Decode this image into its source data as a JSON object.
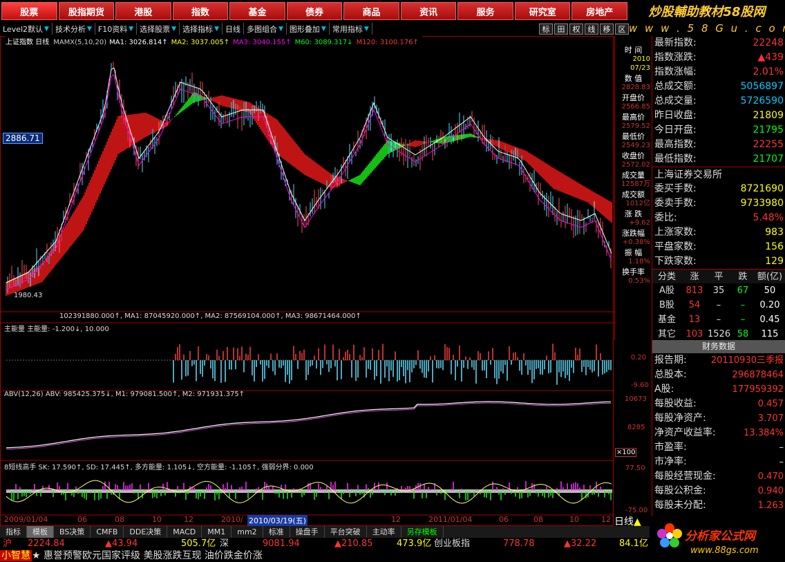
{
  "topnav": [
    "股票",
    "股指期货",
    "港股",
    "指数",
    "基金",
    "债券",
    "商品",
    "资讯",
    "服务",
    "研究室",
    "房地产"
  ],
  "brand": {
    "title": "炒股輔助教材58股网",
    "subtitle": "w w w . 5 8 G u . c o m"
  },
  "toolbar": {
    "items": [
      "Level2默认",
      "技术分析",
      "F10资料",
      "选择股票",
      "选择指标",
      "日线",
      "多图组合",
      "图形叠加",
      "常用指标"
    ]
  },
  "iconbar": [
    "标",
    "田",
    "权",
    "线",
    "移",
    "区"
  ],
  "chart": {
    "title": "上证指数 日线",
    "mamx": "MAMX(5,10,20)",
    "ma_line": [
      {
        "label": "MA1: 3026.814↑",
        "color": "#ffffff"
      },
      {
        "label": "MA2: 3037.005↑",
        "color": "#ffff00"
      },
      {
        "label": "MA3: 3040.155↑",
        "color": "#ff00ff"
      },
      {
        "label": "M60: 3089.317↓",
        "color": "#00ff00"
      },
      {
        "label": "M120: 3100.176↑",
        "color": "#ff3333"
      }
    ],
    "price_tag": "2886.71",
    "low_label": "1980.43",
    "vol_line": "102391880.000↑, MA1: 87045920.000↑, MA2: 87569104.000↑, MA3: 98671464.000↑",
    "zhu_title": "主能量 主能量: -1.200↓, 10.000",
    "zhu_axis": [
      "0.20",
      "-9.60"
    ],
    "abv_title": "ABV(12,26) ABV: 985425.375↓, M1: 979081.500↑, M2: 971931.375↑",
    "abv_axis": [
      "10673",
      "8285",
      "×100"
    ],
    "sk_title": "8短线高手 SK: 17.590↑, SD: 17.445↑, 多方能量: 1.105↓, 空方能量: -1.105↑, 强弱分界: 0.000",
    "sk_axis": [
      "77.50",
      "-75.00"
    ],
    "dates": [
      "2009/01/04",
      "06",
      "08",
      "10",
      "12",
      "2010/",
      "2010/03/19(五)",
      "12",
      "2011/01/04",
      "06",
      "08",
      "10",
      "12"
    ],
    "period": "日线"
  },
  "side": [
    {
      "t": "时 间",
      "v": "2010"
    },
    {
      "t": "",
      "v": "07/23"
    },
    {
      "t": "数 值",
      "v": "2828.83"
    },
    {
      "t": "开盘价",
      "v": "2566.85"
    },
    {
      "t": "最高价",
      "v": "2579.52"
    },
    {
      "t": "最低价",
      "v": "2549.23"
    },
    {
      "t": "收盘价",
      "v": "2572.02"
    },
    {
      "t": "成交量",
      "v": "12587万"
    },
    {
      "t": "成交额",
      "v": "1012亿"
    },
    {
      "t": "涨 跌",
      "v": "+9.62"
    },
    {
      "t": "涨跌幅",
      "v": "+0.38%"
    },
    {
      "t": "振 幅",
      "v": "1.18%"
    },
    {
      "t": "换手率",
      "v": "0.53%"
    }
  ],
  "quote": [
    {
      "k": "最新指数:",
      "v": "22248",
      "c": "r"
    },
    {
      "k": "指数涨跌:",
      "v": "▲439",
      "c": "r"
    },
    {
      "k": "指数涨幅:",
      "v": "2.01%",
      "c": "r"
    },
    {
      "k": "总成交额:",
      "v": "5056897",
      "c": "c"
    },
    {
      "k": "总成交量:",
      "v": "5726590",
      "c": "c"
    },
    {
      "k": "昨日收盘:",
      "v": "21809",
      "c": "yl"
    },
    {
      "k": "今日开盘:",
      "v": "21795",
      "c": "g"
    },
    {
      "k": "最高指数:",
      "v": "22255",
      "c": "r"
    },
    {
      "k": "最低指数:",
      "v": "21707",
      "c": "g"
    }
  ],
  "exchange": "上海证券交易所",
  "quote2": [
    {
      "k": "委买手数:",
      "v": "8721690",
      "c": "yl"
    },
    {
      "k": "委卖手数:",
      "v": "9733980",
      "c": "yl"
    },
    {
      "k": "委比:",
      "v": "5.48%",
      "c": "r"
    },
    {
      "k": "上涨家数:",
      "v": "983",
      "c": "yl"
    },
    {
      "k": "平盘家数:",
      "v": "156",
      "c": "yl"
    },
    {
      "k": "下跌家数:",
      "v": "129",
      "c": "yl"
    }
  ],
  "breadth": {
    "head": [
      "分类",
      "涨",
      "平",
      "跌",
      "额(亿)"
    ],
    "rows": [
      [
        "A股",
        "813",
        "35",
        "67",
        "50"
      ],
      [
        "B股",
        "54",
        "–",
        "–",
        "0.20"
      ],
      [
        "基金",
        "13",
        "–",
        "–",
        "0.45"
      ],
      [
        "其它",
        "103",
        "1526",
        "58",
        "115"
      ]
    ]
  },
  "fin": {
    "title": "财务数据",
    "rows": [
      {
        "k": "报告期:",
        "v": "20110930三季报",
        "c": "r"
      },
      {
        "k": "总股本:",
        "v": "296878464",
        "c": "r"
      },
      {
        "k": "A股:",
        "v": "177959392",
        "c": "r"
      },
      {
        "k": "每股收益:",
        "v": "0.457",
        "c": "r"
      },
      {
        "k": "每股净资产:",
        "v": "3.707",
        "c": "r"
      },
      {
        "k": "净资产收益率:",
        "v": "13.384%",
        "c": "r"
      },
      {
        "k": "市盈率:",
        "v": "–",
        "c": "k"
      },
      {
        "k": "市净率:",
        "v": "–",
        "c": "k"
      },
      {
        "k": "每股经营现金:",
        "v": "0.470",
        "c": "r"
      },
      {
        "k": "每股公积金:",
        "v": "0.940",
        "c": "r"
      },
      {
        "k": "每股未分配:",
        "v": "1.263",
        "c": "r"
      }
    ]
  },
  "tabs": [
    "指标",
    "模板",
    "BS决策",
    "CMFB",
    "DDE决策",
    "MACD",
    "MM1",
    "mm2",
    "标准",
    "操盘手",
    "平台突破",
    "主动率",
    "另存模板"
  ],
  "ticker": [
    {
      "t": "沪",
      "c": "#f33"
    },
    {
      "t": "2224.84",
      "c": "#f33"
    },
    {
      "t": "▲43.94",
      "c": "#f33"
    },
    {
      "t": "505.7亿",
      "c": "#ff0"
    },
    {
      "t": "深",
      "c": "#ddd"
    },
    {
      "t": "9081.94",
      "c": "#f33"
    },
    {
      "t": "▲210.85",
      "c": "#f33"
    },
    {
      "t": "473.9亿",
      "c": "#ff0"
    },
    {
      "t": "创业板指",
      "c": "#ddd"
    },
    {
      "t": "778.78",
      "c": "#f33"
    },
    {
      "t": "▲32.22",
      "c": "#f33"
    },
    {
      "t": "84.1亿",
      "c": "#ff0"
    }
  ],
  "news": "★ 惠誉预警欧元国家评级 美股涨跌互现 油价跌金价涨",
  "news_prefix": "小智慧",
  "logo2": {
    "l1": "分析家公式网",
    "l2": "www.88gs.com"
  }
}
